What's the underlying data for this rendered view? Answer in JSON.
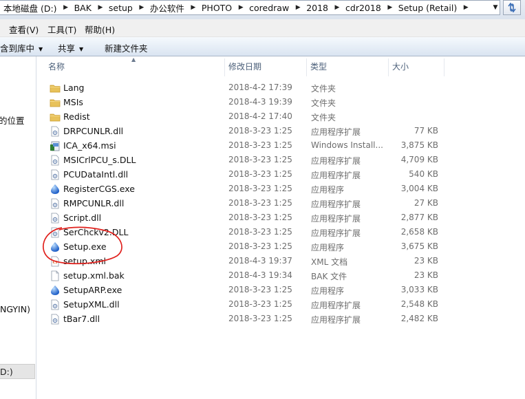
{
  "address_bar": {
    "crumbs": [
      "本地磁盘 (D:)",
      "BAK",
      "setup",
      "办公软件",
      "PHOTO",
      "coredraw",
      "2018",
      "cdr2018",
      "Setup (Retail)"
    ]
  },
  "menu": {
    "view": "查看(V)",
    "tools": "工具(T)",
    "help": "帮助(H)"
  },
  "command_bar": {
    "library": "含到库中",
    "share": "共享",
    "new_folder": "新建文件夹"
  },
  "nav_pane": {
    "location": "的位置",
    "ngyin": "NGYIN)",
    "drive": "D:)"
  },
  "columns": {
    "name": "名称",
    "date": "修改日期",
    "type": "类型",
    "size": "大小"
  },
  "files": [
    {
      "name": "Lang",
      "date": "2018-4-2 17:39",
      "type": "文件夹",
      "size": "",
      "icon": "folder-icon"
    },
    {
      "name": "MSIs",
      "date": "2018-4-3 19:39",
      "type": "文件夹",
      "size": "",
      "icon": "folder-icon"
    },
    {
      "name": "Redist",
      "date": "2018-4-2 17:40",
      "type": "文件夹",
      "size": "",
      "icon": "folder-icon"
    },
    {
      "name": "DRPCUNLR.dll",
      "date": "2018-3-23 1:25",
      "type": "应用程序扩展",
      "size": "77 KB",
      "icon": "dll-icon"
    },
    {
      "name": "ICA_x64.msi",
      "date": "2018-3-23 1:25",
      "type": "Windows Install...",
      "size": "3,875 KB",
      "icon": "msi-icon"
    },
    {
      "name": "MSICrlPCU_s.DLL",
      "date": "2018-3-23 1:25",
      "type": "应用程序扩展",
      "size": "4,709 KB",
      "icon": "dll-icon"
    },
    {
      "name": "PCUDataIntl.dll",
      "date": "2018-3-23 1:25",
      "type": "应用程序扩展",
      "size": "540 KB",
      "icon": "dll-icon"
    },
    {
      "name": "RegisterCGS.exe",
      "date": "2018-3-23 1:25",
      "type": "应用程序",
      "size": "3,004 KB",
      "icon": "exe-icon"
    },
    {
      "name": "RMPCUNLR.dll",
      "date": "2018-3-23 1:25",
      "type": "应用程序扩展",
      "size": "27 KB",
      "icon": "dll-icon"
    },
    {
      "name": "Script.dll",
      "date": "2018-3-23 1:25",
      "type": "应用程序扩展",
      "size": "2,877 KB",
      "icon": "dll-icon"
    },
    {
      "name": "SerChckv2.DLL",
      "date": "2018-3-23 1:25",
      "type": "应用程序扩展",
      "size": "2,658 KB",
      "icon": "dll-icon"
    },
    {
      "name": "Setup.exe",
      "date": "2018-3-23 1:25",
      "type": "应用程序",
      "size": "3,675 KB",
      "icon": "exe-icon"
    },
    {
      "name": "setup.xml",
      "date": "2018-4-3 19:37",
      "type": "XML 文档",
      "size": "23 KB",
      "icon": "xml-icon"
    },
    {
      "name": "setup.xml.bak",
      "date": "2018-4-3 19:34",
      "type": "BAK 文件",
      "size": "23 KB",
      "icon": "blank-file-icon"
    },
    {
      "name": "SetupARP.exe",
      "date": "2018-3-23 1:25",
      "type": "应用程序",
      "size": "3,033 KB",
      "icon": "exe-icon"
    },
    {
      "name": "SetupXML.dll",
      "date": "2018-3-23 1:25",
      "type": "应用程序扩展",
      "size": "2,548 KB",
      "icon": "dll-icon"
    },
    {
      "name": "tBar7.dll",
      "date": "2018-3-23 1:25",
      "type": "应用程序扩展",
      "size": "2,482 KB",
      "icon": "dll-icon"
    }
  ],
  "colors": {
    "annotation_circle": "#e0201c",
    "folder": "#e8c25a",
    "header_text": "#4c607a",
    "secondary_text": "#6d6d6d"
  }
}
